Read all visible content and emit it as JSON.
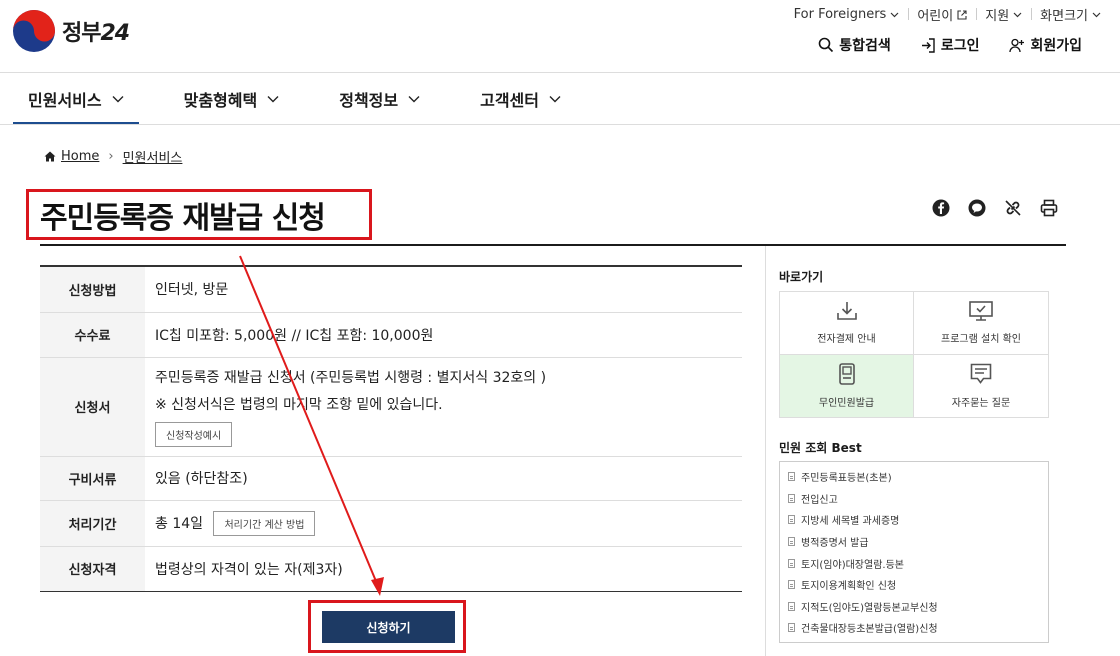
{
  "header": {
    "logo_text": "정부",
    "logo_num": "24",
    "util": [
      {
        "label": "For Foreigners",
        "icon": "chevron-down-icon"
      },
      {
        "label": "어린이",
        "icon": "external-link-icon"
      },
      {
        "label": "지원",
        "icon": "chevron-down-icon"
      },
      {
        "label": "화면크기",
        "icon": "chevron-down-icon"
      }
    ],
    "quick": [
      {
        "label": "통합검색",
        "icon": "search-icon"
      },
      {
        "label": "로그인",
        "icon": "login-icon"
      },
      {
        "label": "회원가입",
        "icon": "user-add-icon"
      }
    ]
  },
  "gnb": [
    {
      "label": "민원서비스"
    },
    {
      "label": "맞춤형혜택"
    },
    {
      "label": "정책정보"
    },
    {
      "label": "고객센터"
    }
  ],
  "breadcrumb": {
    "home": "Home",
    "current": "민원서비스"
  },
  "page_title": "주민등록증 재발급 신청",
  "share_icons": [
    "facebook-icon",
    "kakao-icon",
    "link-icon",
    "print-icon"
  ],
  "info": {
    "method": {
      "label": "신청방법",
      "value": "인터넷, 방문"
    },
    "fee": {
      "label": "수수료",
      "value": "IC칩 미포함: 5,000원 // IC칩 포함: 10,000원"
    },
    "form": {
      "label": "신청서",
      "line1": "주민등록증 재발급 신청서 (주민등록법 시행령 : 별지서식 32호의 )",
      "line2": "※ 신청서식은 법령의 마지막 조항 밑에 있습니다.",
      "button": "신청작성예시"
    },
    "docs": {
      "label": "구비서류",
      "value": "있음 (하단참조)"
    },
    "period": {
      "label": "처리기간",
      "value": "총 14일",
      "button": "처리기간 계산 방법"
    },
    "qualify": {
      "label": "신청자격",
      "value": "법령상의 자격이 있는 자(제3자)"
    }
  },
  "apply_button": "신청하기",
  "sidebar": {
    "shortcut_title": "바로가기",
    "shortcuts": [
      {
        "label": "전자결제 안내",
        "icon": "download-icon"
      },
      {
        "label": "프로그램 설치 확인",
        "icon": "monitor-check-icon"
      },
      {
        "label": "무인민원발급",
        "icon": "kiosk-icon"
      },
      {
        "label": "자주묻는 질문",
        "icon": "chat-icon"
      }
    ],
    "best_title": "민원 조회 Best",
    "best": [
      "주민등록표등본(초본)",
      "전입신고",
      "지방세 세목별 과세증명",
      "병적증명서 발급",
      "토지(임야)대장열람.등본",
      "토지이용계획확인 신청",
      "지적도(임야도)열람등본교부신청",
      "건축물대장등초본발급(열람)신청"
    ]
  },
  "colors": {
    "accent_navy": "#1d3a64",
    "highlight_red": "#d9161d",
    "active_tab": "#1d4d8f"
  }
}
